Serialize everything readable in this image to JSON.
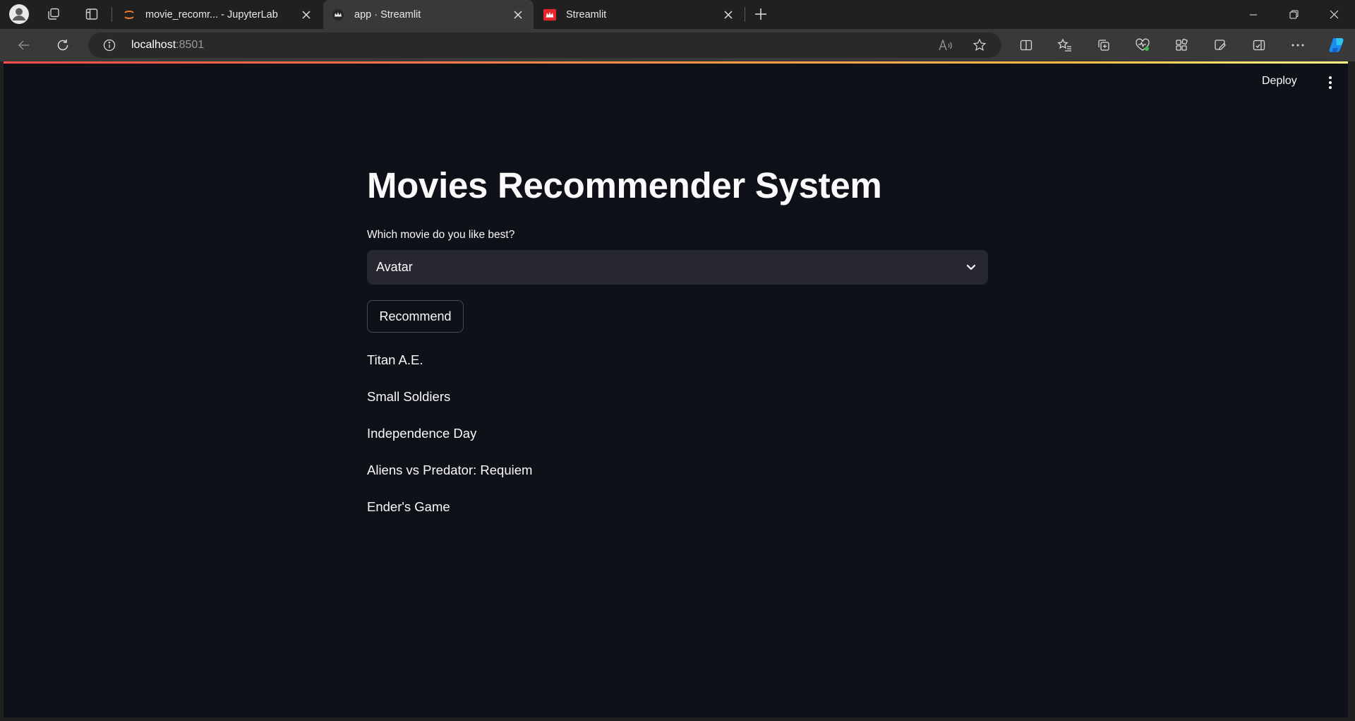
{
  "browser": {
    "tabs": [
      {
        "title": "movie_recomr... - JupyterLab",
        "active": false
      },
      {
        "title": "app · Streamlit",
        "active": true
      },
      {
        "title": "Streamlit",
        "active": false
      }
    ],
    "address": {
      "host": "localhost",
      "port": ":8501"
    }
  },
  "header": {
    "deploy_label": "Deploy"
  },
  "app": {
    "title": "Movies Recommender System",
    "select_label": "Which movie do you like best?",
    "selected_movie": "Avatar",
    "button_label": "Recommend",
    "recommendations": [
      "Titan A.E.",
      "Small Soldiers",
      "Independence Day",
      "Aliens vs Predator: Requiem",
      "Ender's Game"
    ]
  },
  "colors": {
    "app_background": "#0e1117",
    "select_background": "#262730",
    "text": "#fafafa",
    "accent_red": "#ff4b4b"
  }
}
